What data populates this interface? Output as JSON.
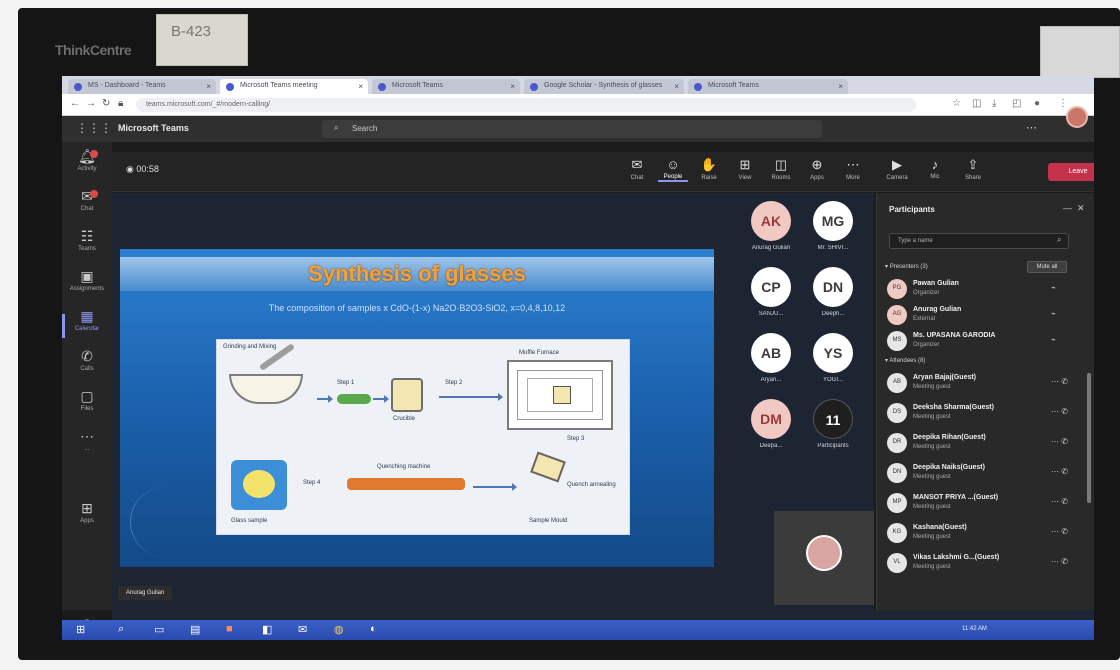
{
  "photo": {
    "brand": "ThinkCentre",
    "sticky_note": "B-423"
  },
  "browser": {
    "tabs": [
      {
        "label": "MS - Dashboard - Teams",
        "active": false
      },
      {
        "label": "Microsoft Teams meeting",
        "active": true
      },
      {
        "label": "Microsoft Teams",
        "active": false
      },
      {
        "label": "Google Scholar - Synthesis of glasses",
        "active": false
      },
      {
        "label": "Microsoft Teams",
        "active": false
      }
    ],
    "url": "teams.microsoft.com/_#/modern-calling/"
  },
  "teams": {
    "app_name": "Microsoft Teams",
    "search_placeholder": "Search"
  },
  "rail": [
    {
      "icon": "bell-icon",
      "label": "Activity",
      "badge": true
    },
    {
      "icon": "chat-icon",
      "label": "Chat",
      "badge": true
    },
    {
      "icon": "teams-icon",
      "label": "Teams",
      "badge": false
    },
    {
      "icon": "assignments-icon",
      "label": "Assignments",
      "badge": false
    },
    {
      "icon": "calendar-icon",
      "label": "Calendar",
      "badge": false,
      "active": true
    },
    {
      "icon": "calls-icon",
      "label": "Calls",
      "badge": false
    },
    {
      "icon": "files-icon",
      "label": "Files",
      "badge": false
    },
    {
      "icon": "more-icon",
      "label": "...",
      "badge": false
    },
    {
      "icon": "apps-icon",
      "label": "Apps",
      "badge": false
    },
    {
      "icon": "help-icon",
      "label": "Help",
      "badge": false
    }
  ],
  "meeting": {
    "timer": "00:58",
    "toolbar": [
      {
        "icon": "chat-icon",
        "label": "Chat"
      },
      {
        "icon": "people-icon",
        "label": "People",
        "selected": true
      },
      {
        "icon": "hand-icon",
        "label": "Raise"
      },
      {
        "icon": "view-icon",
        "label": "View"
      },
      {
        "icon": "rooms-icon",
        "label": "Rooms"
      },
      {
        "icon": "apps-icon",
        "label": "Apps"
      },
      {
        "icon": "more-icon",
        "label": "More"
      },
      {
        "icon": "camera-icon",
        "label": "Camera"
      },
      {
        "icon": "mic-icon",
        "label": "Mic"
      },
      {
        "icon": "share-icon",
        "label": "Share"
      }
    ],
    "leave_label": "Leave",
    "presenter_chip": "Anurag Gulian"
  },
  "slide": {
    "title": "Synthesis of glasses",
    "subtitle": "The composition of samples x CdO-(1-x) Na2O·B2O3-SiO2, x=0,4,8,10,12",
    "labels": {
      "mixing": "Grinding and Mixing",
      "step1": "Step 1",
      "step2": "Step 2",
      "step3": "Step 3",
      "muffle": "Muffle Furnace",
      "quench": "Quenching machine",
      "step4": "Step 4",
      "annealing": "Quench annealing",
      "disc": "Glass sample",
      "crucible": "Crucible",
      "sample": "Sample Mould"
    }
  },
  "tiles": [
    {
      "initials": "AK",
      "name": "Anurag Gulian",
      "bg": "#f0c9c3",
      "fg": "#9a3a3a"
    },
    {
      "initials": "MG",
      "name": "Mr. SHIVI...",
      "bg": "#ffffff",
      "fg": "#3c3c3c"
    },
    {
      "initials": "CP",
      "name": "SANJU...",
      "bg": "#ffffff",
      "fg": "#3c3c3c"
    },
    {
      "initials": "DN",
      "name": "Deeph...",
      "bg": "#ffffff",
      "fg": "#3c3c3c"
    },
    {
      "initials": "AB",
      "name": "Aryan...",
      "bg": "#ffffff",
      "fg": "#3c3c3c"
    },
    {
      "initials": "YS",
      "name": "YOGI...",
      "bg": "#ffffff",
      "fg": "#3c3c3c"
    },
    {
      "initials": "DM",
      "name": "Deepa...",
      "bg": "#f0c9c3",
      "fg": "#9a3a3a"
    },
    {
      "initials": "11",
      "name": "Participants",
      "bg": "#1f1f1f",
      "fg": "#ffffff"
    }
  ],
  "participants": {
    "title": "Participants",
    "search_placeholder": "Type a name",
    "presenters_header": "Presenters (3)",
    "mute_all": "Mute all",
    "attendees_header": "Attendees (8)",
    "presenters": [
      {
        "initials": "PG",
        "name": "Pawan Gulian",
        "role": "Organizer"
      },
      {
        "initials": "AG",
        "name": "Anurag Gulian",
        "role": "External"
      },
      {
        "initials": "MS",
        "name": "Ms. UPASANA GARODIA",
        "role": "Organizer"
      }
    ],
    "attendees": [
      {
        "initials": "AB",
        "name": "Aryan Bajaj(Guest)",
        "role": "Meeting guest"
      },
      {
        "initials": "DS",
        "name": "Deeksha Sharma(Guest)",
        "role": "Meeting guest"
      },
      {
        "initials": "DR",
        "name": "Deepika Rihan(Guest)",
        "role": "Meeting guest"
      },
      {
        "initials": "DN",
        "name": "Deepika Naiks(Guest)",
        "role": "Meeting guest"
      },
      {
        "initials": "MP",
        "name": "MANSOT PRIYA ...(Guest)",
        "role": "Meeting guest"
      },
      {
        "initials": "KG",
        "name": "Kashana(Guest)",
        "role": "Meeting guest"
      },
      {
        "initials": "VL",
        "name": "Vikas Lakshmi G...(Guest)",
        "role": "Meeting guest"
      }
    ]
  },
  "taskbar": {
    "clock": "11:42 AM"
  }
}
